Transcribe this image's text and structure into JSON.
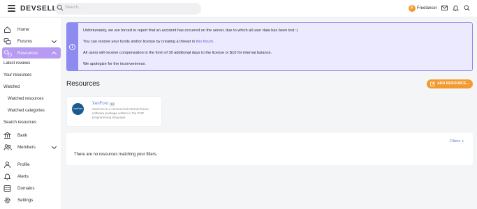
{
  "header": {
    "logo": "DEVSELL",
    "search_placeholder": "Search...",
    "user_initial": "F",
    "user_name": "Freelancer"
  },
  "sidebar": {
    "home": "Home",
    "forums": "Forums",
    "resources": "Resources",
    "latest_reviews": "Latest reviews",
    "your_resources": "Your resources",
    "watched": "Watched",
    "watched_resources": "Watched resources",
    "watched_categories": "Watched categories",
    "search_resources": "Search resources",
    "bank": "Bank",
    "members": "Members",
    "profile": "Profile",
    "alerts": "Alerts",
    "domains": "Domains",
    "settings": "Settings"
  },
  "notice": {
    "line1": "Unfortunately, we are forced to report that an accident has occurred on the server, due to which all user data has been lost :(",
    "line2_prefix": "You can restore your funds and/or license by creating a thread in ",
    "line2_link": "this forum",
    "line2_suffix": ".",
    "line3": "All users will receive compensation in the form of 30 additional days to the license or $10 for internal balance.",
    "line4": "We apologize for the inconvenience."
  },
  "main": {
    "title": "Resources",
    "add_button": "ADD RESOURCE...",
    "filters": "Filters",
    "empty_message": "There are no resources matching your filters."
  },
  "category_card": {
    "logo_text": "xenForo",
    "title": "XenForo",
    "count": "14",
    "description": "XenForo is a commercial Internet forum software package written in the PHP programming language."
  }
}
